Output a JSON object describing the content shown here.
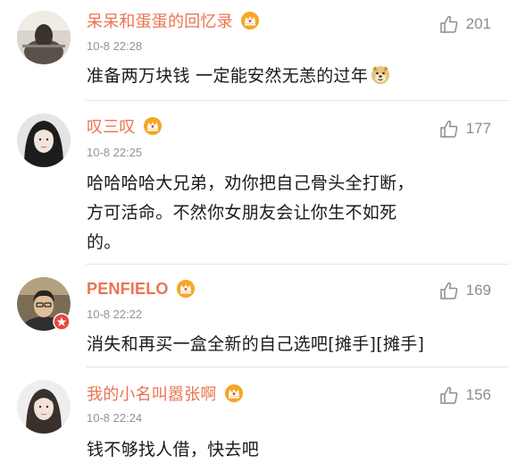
{
  "comments": [
    {
      "username": "呆呆和蛋蛋的回忆录",
      "timestamp": "10-8 22:28",
      "like_count": "201",
      "text_lines": [
        "准备两万块钱 一定能安然无恙的过年"
      ],
      "trailing_emoji": "doge-emoji-icon"
    },
    {
      "username": "叹三叹",
      "timestamp": "10-8 22:25",
      "like_count": "177",
      "text_lines": [
        "哈哈哈哈大兄弟，劝你把自己骨头全打断，",
        "方可活命。不然你女朋友会让你生不如死",
        "的。"
      ]
    },
    {
      "username": "PENFIELO",
      "timestamp": "10-8 22:22",
      "like_count": "169",
      "text_lines": [
        "消失和再买一盒全新的自己选吧[摊手][摊手]"
      ]
    },
    {
      "username": "我的小名叫嚣张啊",
      "timestamp": "10-8 22:24",
      "like_count": "156",
      "text_lines": [
        "钱不够找人借，快去吧"
      ]
    }
  ],
  "icons": {
    "vip_badge": "vip-crown-badge-icon",
    "like": "thumbs-up-icon",
    "verified_badge": "red-star-badge-icon"
  },
  "colors": {
    "username": "#eb7350",
    "timestamp": "#939393",
    "body_text": "#1a1a1a",
    "like": "#8c8c8c",
    "vip_badge": "#f6a623"
  }
}
